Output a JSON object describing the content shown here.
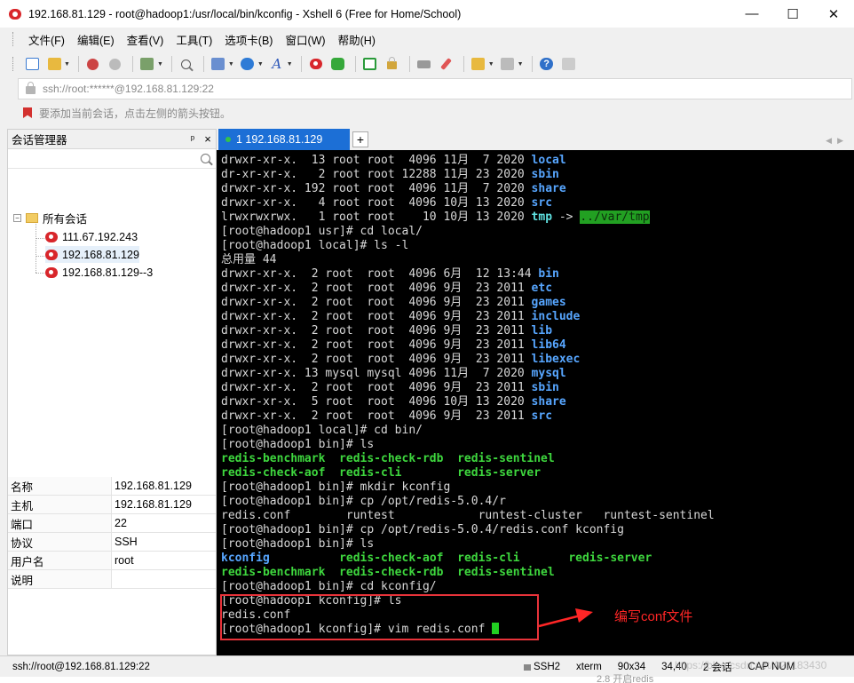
{
  "window": {
    "title": "192.168.81.129 - root@hadoop1:/usr/local/bin/kconfig - Xshell 6 (Free for Home/School)",
    "minimize": "—",
    "maximize": "☐",
    "close": "✕"
  },
  "menu": [
    "文件(F)",
    "编辑(E)",
    "查看(V)",
    "工具(T)",
    "选项卡(B)",
    "窗口(W)",
    "帮助(H)"
  ],
  "address": "ssh://root:******@192.168.81.129:22",
  "hint": "要添加当前会话，点击左侧的箭头按钮。",
  "session_manager": {
    "title": "会话管理器",
    "pin": "ᵖ",
    "close": "×",
    "tree": {
      "root": "所有会话",
      "items": [
        "111.67.192.243",
        "192.168.81.129",
        "192.168.81.129--3"
      ]
    },
    "properties": [
      {
        "k": "名称",
        "v": "192.168.81.129"
      },
      {
        "k": "主机",
        "v": "192.168.81.129"
      },
      {
        "k": "端口",
        "v": "22"
      },
      {
        "k": "协议",
        "v": "SSH"
      },
      {
        "k": "用户名",
        "v": "root"
      },
      {
        "k": "说明",
        "v": ""
      }
    ]
  },
  "tabs": [
    {
      "label": "1 192.168.81.129"
    }
  ],
  "tab_add": "+",
  "terminal": {
    "lines": [
      [
        {
          "t": "drwxr-xr-x.  13 root root  4096 11月  7 2020 "
        },
        {
          "t": "local",
          "c": "c-blue"
        }
      ],
      [
        {
          "t": "dr-xr-xr-x.   2 root root 12288 11月 23 2020 "
        },
        {
          "t": "sbin",
          "c": "c-blue"
        }
      ],
      [
        {
          "t": "drwxr-xr-x. 192 root root  4096 11月  7 2020 "
        },
        {
          "t": "share",
          "c": "c-blue"
        }
      ],
      [
        {
          "t": "drwxr-xr-x.   4 root root  4096 10月 13 2020 "
        },
        {
          "t": "src",
          "c": "c-blue"
        }
      ],
      [
        {
          "t": "lrwxrwxrwx.   1 root root    10 10月 13 2020 "
        },
        {
          "t": "tmp",
          "c": "c-link"
        },
        {
          "t": " -> "
        },
        {
          "t": "../var/tmp",
          "c": "c-hl"
        }
      ],
      [
        {
          "t": "[root@hadoop1 usr]# cd local/"
        }
      ],
      [
        {
          "t": "[root@hadoop1 local]# ls -l"
        }
      ],
      [
        {
          "t": "总用量 44"
        }
      ],
      [
        {
          "t": "drwxr-xr-x.  2 root  root  4096 6月  12 13:44 "
        },
        {
          "t": "bin",
          "c": "c-blue"
        }
      ],
      [
        {
          "t": "drwxr-xr-x.  2 root  root  4096 9月  23 2011 "
        },
        {
          "t": "etc",
          "c": "c-blue"
        }
      ],
      [
        {
          "t": "drwxr-xr-x.  2 root  root  4096 9月  23 2011 "
        },
        {
          "t": "games",
          "c": "c-blue"
        }
      ],
      [
        {
          "t": "drwxr-xr-x.  2 root  root  4096 9月  23 2011 "
        },
        {
          "t": "include",
          "c": "c-blue"
        }
      ],
      [
        {
          "t": "drwxr-xr-x.  2 root  root  4096 9月  23 2011 "
        },
        {
          "t": "lib",
          "c": "c-blue"
        }
      ],
      [
        {
          "t": "drwxr-xr-x.  2 root  root  4096 9月  23 2011 "
        },
        {
          "t": "lib64",
          "c": "c-blue"
        }
      ],
      [
        {
          "t": "drwxr-xr-x.  2 root  root  4096 9月  23 2011 "
        },
        {
          "t": "libexec",
          "c": "c-blue"
        }
      ],
      [
        {
          "t": "drwxr-xr-x. 13 mysql mysql 4096 11月  7 2020 "
        },
        {
          "t": "mysql",
          "c": "c-blue"
        }
      ],
      [
        {
          "t": "drwxr-xr-x.  2 root  root  4096 9月  23 2011 "
        },
        {
          "t": "sbin",
          "c": "c-blue"
        }
      ],
      [
        {
          "t": "drwxr-xr-x.  5 root  root  4096 10月 13 2020 "
        },
        {
          "t": "share",
          "c": "c-blue"
        }
      ],
      [
        {
          "t": "drwxr-xr-x.  2 root  root  4096 9月  23 2011 "
        },
        {
          "t": "src",
          "c": "c-blue"
        }
      ],
      [
        {
          "t": "[root@hadoop1 local]# cd bin/"
        }
      ],
      [
        {
          "t": "[root@hadoop1 bin]# ls"
        }
      ],
      [
        {
          "t": "redis-benchmark  redis-check-rdb  redis-sentinel",
          "c": "c-green"
        }
      ],
      [
        {
          "t": "redis-check-aof  redis-cli        redis-server",
          "c": "c-green"
        }
      ],
      [
        {
          "t": "[root@hadoop1 bin]# mkdir kconfig"
        }
      ],
      [
        {
          "t": "[root@hadoop1 bin]# cp /opt/redis-5.0.4/r"
        }
      ],
      [
        {
          "t": "redis.conf        runtest            runtest-cluster   runtest-sentinel"
        }
      ],
      [
        {
          "t": "[root@hadoop1 bin]# cp /opt/redis-5.0.4/redis.conf kconfig"
        }
      ],
      [
        {
          "t": "[root@hadoop1 bin]# ls"
        }
      ],
      [
        {
          "t": "kconfig",
          "c": "c-blue"
        },
        {
          "t": "          "
        },
        {
          "t": "redis-check-aof  redis-cli       redis-server",
          "c": "c-green"
        }
      ],
      [
        {
          "t": "redis-benchmark  redis-check-rdb  redis-sentinel",
          "c": "c-green"
        }
      ],
      [
        {
          "t": "[root@hadoop1 bin]# cd kconfig/"
        }
      ],
      [
        {
          "t": "[root@hadoop1 kconfig]# ls"
        }
      ],
      [
        {
          "t": "redis.conf"
        }
      ],
      [
        {
          "t": "[root@hadoop1 kconfig]# vim redis.conf "
        },
        {
          "cursor": true
        }
      ]
    ],
    "annotation": "编写conf文件"
  },
  "status": {
    "left": "ssh://root@192.168.81.129:22",
    "items": [
      "SSH2",
      "xterm",
      "90x34",
      "34,40",
      "2 会话"
    ],
    "extra": "CAP NUM"
  },
  "page_footer": "2.8 开启redis",
  "watermark": "https://blog.csdn.net/A21183430"
}
